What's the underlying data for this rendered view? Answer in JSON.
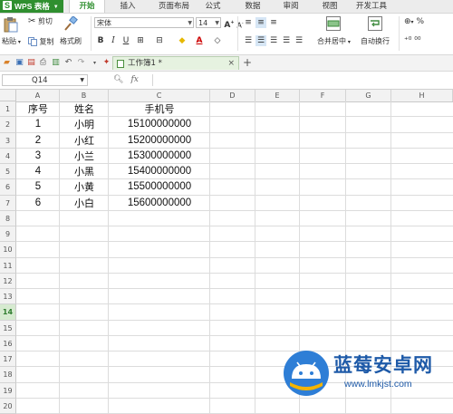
{
  "app": {
    "logo_text": "WPS 表格",
    "logo_letter": "S",
    "accent_color": "#2f8f2f"
  },
  "menu_tabs": [
    {
      "label": "开始",
      "active": true
    },
    {
      "label": "插入"
    },
    {
      "label": "页面布局"
    },
    {
      "label": "公式"
    },
    {
      "label": "数据"
    },
    {
      "label": "审阅"
    },
    {
      "label": "视图"
    },
    {
      "label": "开发工具"
    }
  ],
  "ribbon": {
    "cut": "剪切",
    "copy": "复制",
    "paste": "粘贴",
    "format_painter": "格式刷",
    "font_name": "宋体",
    "font_size": "14",
    "merge_center": "合并居中",
    "wrap_text": "自动换行",
    "bold": "B",
    "italic": "I",
    "underline": "U",
    "font_color_letter": "A",
    "grow_font": "A",
    "shrink_font": "A",
    "percent": "%"
  },
  "document_tab": {
    "title": "工作簿1 *",
    "close": "×"
  },
  "add_tab": "+",
  "formula_bar": {
    "name_box": "Q14",
    "fx": "fx",
    "value": ""
  },
  "columns": [
    "A",
    "B",
    "C",
    "D",
    "E",
    "F",
    "G",
    "H"
  ],
  "rows": [
    "1",
    "2",
    "3",
    "4",
    "5",
    "6",
    "7",
    "8",
    "9",
    "10",
    "11",
    "12",
    "13",
    "14",
    "15",
    "16",
    "17",
    "18",
    "19",
    "20"
  ],
  "selected_row": "14",
  "table": {
    "headers": [
      "序号",
      "姓名",
      "手机号"
    ],
    "data": [
      [
        "1",
        "小明",
        "15100000000"
      ],
      [
        "2",
        "小红",
        "15200000000"
      ],
      [
        "3",
        "小兰",
        "15300000000"
      ],
      [
        "4",
        "小黑",
        "15400000000"
      ],
      [
        "5",
        "小黄",
        "15500000000"
      ],
      [
        "6",
        "小白",
        "15600000000"
      ]
    ]
  },
  "watermark": {
    "brand": "蓝莓安卓网",
    "url": "www.lmkjst.com"
  }
}
